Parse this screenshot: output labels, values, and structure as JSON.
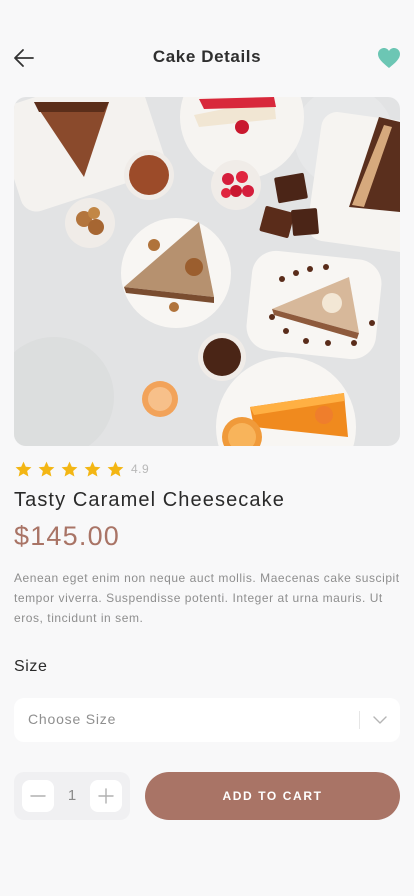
{
  "header": {
    "title": "Cake Details",
    "back_icon": "arrow-left-icon",
    "favorite_icon": "heart-icon"
  },
  "product": {
    "image_alt": "cake-slices-image",
    "rating": 4.9,
    "rating_label": "4.9",
    "star_count": 5,
    "name": "Tasty Caramel Cheesecake",
    "price": "$145.00",
    "description": "Aenean eget enim non neque auct mollis. Maecenas cake suscipit tempor viverra. Suspendisse potenti. Integer at urna mauris. Ut eros, tincidunt in sem."
  },
  "size": {
    "label": "Size",
    "placeholder": "Choose Size"
  },
  "quantity": {
    "value": "1"
  },
  "cart": {
    "button_label": "ADD TO CART"
  },
  "colors": {
    "accent": "#a97466",
    "heart": "#6cc6b4",
    "star": "#f3b614",
    "background": "#f8f8f9"
  }
}
